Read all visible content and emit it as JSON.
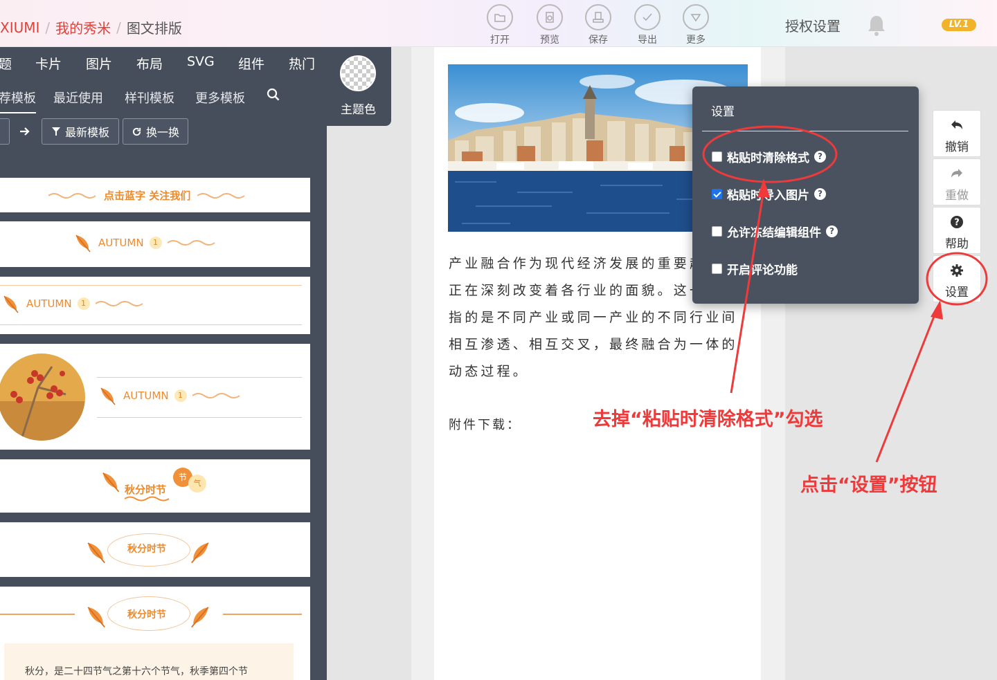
{
  "header": {
    "breadcrumb": [
      "XIUMI",
      "我的秀米",
      "图文排版"
    ],
    "tools": [
      {
        "label": "打开",
        "icon": "folder-icon"
      },
      {
        "label": "预览",
        "icon": "preview-icon"
      },
      {
        "label": "保存",
        "icon": "save-icon"
      },
      {
        "label": "导出",
        "icon": "check-icon"
      },
      {
        "label": "更多",
        "icon": "more-icon"
      }
    ],
    "auth_label": "授权设置",
    "level_badge": "LV.1"
  },
  "left_panel": {
    "main_tabs": [
      "题",
      "卡片",
      "图片",
      "布局",
      "SVG",
      "组件",
      "热门"
    ],
    "sub_tabs": [
      "荐模板",
      "最近使用",
      "样刊模板",
      "更多模板"
    ],
    "theme_label": "主题色",
    "buttons": {
      "newest": "最新模板",
      "refresh": "换一换"
    },
    "templates": {
      "follow_text": "点击蓝字 关注我们",
      "autumn_word": "AUTUMN",
      "badge_num": "1",
      "festival": "秋分时节",
      "badge_jie": "节",
      "badge_qi": "气",
      "desc": "秋分，是二十四节气之第十六个节气，秋季第四个节"
    }
  },
  "editor": {
    "body_text": "产业融合作为现代经济发展的重要趋势，正在深刻改变着各行业的面貌。这一概念指的是不同产业或同一产业的不同行业间相互渗透、相互交叉，最终融合为一体的动态过程。",
    "attachment_label": "附件下载："
  },
  "right_tools": [
    {
      "label": "撤销",
      "icon": "undo-icon",
      "dim": false
    },
    {
      "label": "重做",
      "icon": "redo-icon",
      "dim": true
    },
    {
      "label": "帮助",
      "icon": "help-icon",
      "dim": false
    },
    {
      "label": "设置",
      "icon": "gear-icon",
      "dim": false
    }
  ],
  "settings_popup": {
    "title": "设置",
    "options": [
      {
        "label": "粘贴时清除格式",
        "checked": false
      },
      {
        "label": "粘贴时导入图片",
        "checked": true
      },
      {
        "label": "允许冻结编辑组件",
        "checked": false
      },
      {
        "label": "开启评论功能",
        "checked": false
      }
    ]
  },
  "annotations": {
    "uncheck_hint": "去掉“粘贴时清除格式”勾选",
    "click_hint": "点击“设置”按钮"
  },
  "colors": {
    "accent_red": "#ee3a3a",
    "panel": "#464e5c",
    "orange": "#ee8a2a",
    "checkbox_blue": "#1f73e8"
  }
}
